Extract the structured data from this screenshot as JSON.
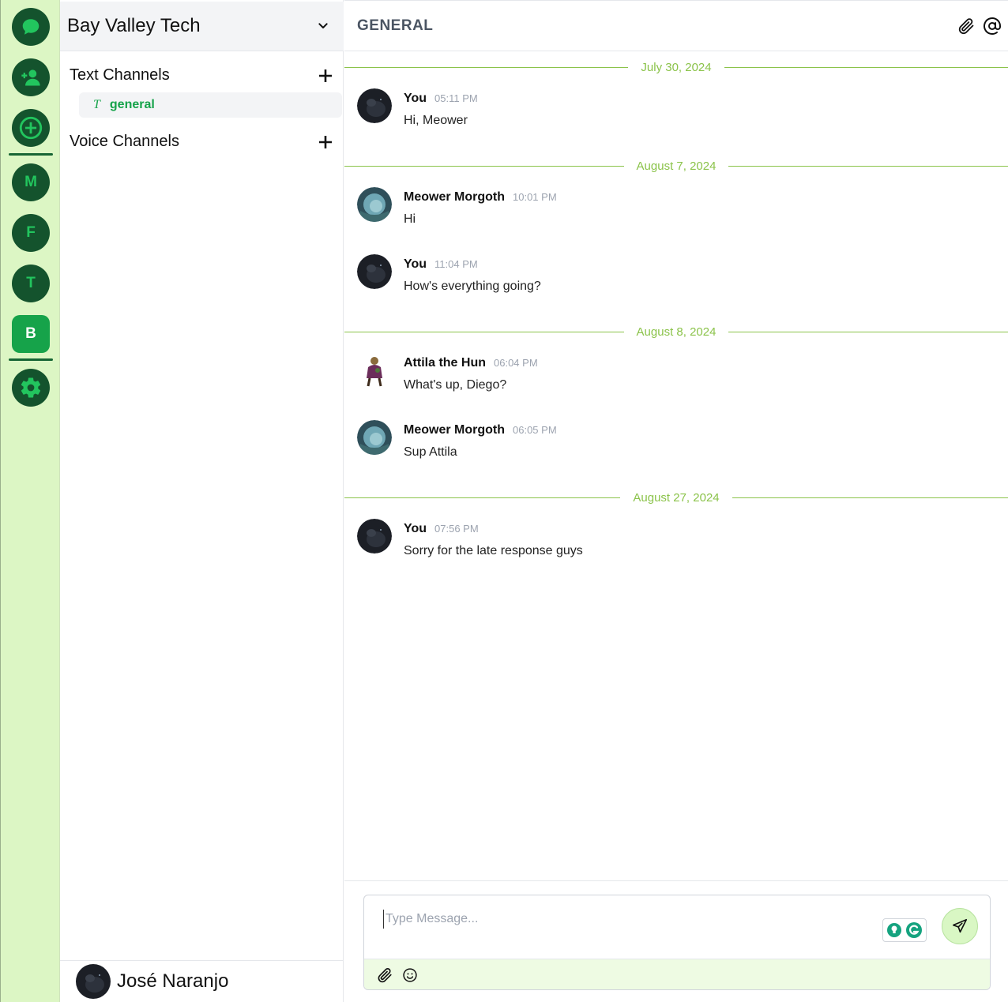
{
  "colors": {
    "rail_bg": "#dcf6c4",
    "rail_button": "#14532d",
    "rail_button_active": "#16a34a",
    "accent_green": "#16a34a",
    "date_green": "#8bc34a"
  },
  "rail": {
    "items": [
      {
        "icon": "chat-bubble-icon"
      },
      {
        "icon": "add-friend-icon"
      },
      {
        "icon": "plus-circle-icon"
      },
      {
        "label": "M"
      },
      {
        "label": "F"
      },
      {
        "label": "T"
      },
      {
        "label": "B",
        "active": true
      },
      {
        "icon": "gear-icon"
      }
    ]
  },
  "sidebar": {
    "server_name": "Bay Valley Tech",
    "text_channels_label": "Text Channels",
    "voice_channels_label": "Voice Channels",
    "channels": [
      {
        "prefix": "T",
        "name": "general",
        "active": true
      }
    ],
    "user": {
      "name": "José Naranjo"
    }
  },
  "main": {
    "channel_title": "GENERAL",
    "header_icons": [
      "paperclip-icon",
      "at-sign-icon"
    ],
    "dates": [
      "July 30, 2024",
      "August 7, 2024",
      "August 8, 2024",
      "August 27, 2024"
    ],
    "messages": [
      {
        "author": "You",
        "time": "05:11 PM",
        "text": "Hi, Meower"
      },
      {
        "author": "Meower Morgoth",
        "time": "10:01 PM",
        "text": "Hi"
      },
      {
        "author": "You",
        "time": "11:04 PM",
        "text": "How's everything going?"
      },
      {
        "author": "Attila the Hun",
        "time": "06:04 PM",
        "text": "What's up, Diego?"
      },
      {
        "author": "Meower Morgoth",
        "time": "06:05 PM",
        "text": "Sup Attila"
      },
      {
        "author": "You",
        "time": "07:56 PM",
        "text": "Sorry for the late response guys"
      }
    ]
  },
  "composer": {
    "placeholder": "Type Message...",
    "value": "",
    "tool_icons": [
      "paperclip-icon",
      "smiley-icon"
    ],
    "send_icon": "paper-plane-icon"
  }
}
